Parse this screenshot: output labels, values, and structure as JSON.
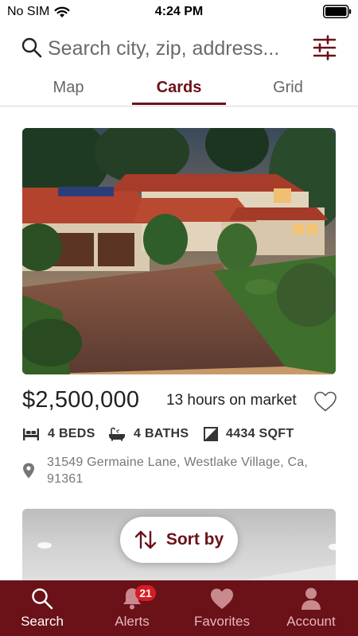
{
  "status_bar": {
    "carrier": "No SIM",
    "time": "4:24 PM"
  },
  "search": {
    "placeholder": "Search city, zip, address..."
  },
  "tabs": [
    {
      "label": "Map"
    },
    {
      "label": "Cards",
      "active": true
    },
    {
      "label": "Grid"
    }
  ],
  "listing": {
    "price": "$2,500,000",
    "time_on_market": "13 hours on market",
    "beds": "4 BEDS",
    "baths": "4 BATHS",
    "sqft": "4434 SQFT",
    "address": "31549 Germaine Lane, Westlake Village, Ca, 91361"
  },
  "sort": {
    "label": "Sort by"
  },
  "bottom_nav": {
    "items": [
      {
        "label": "Search",
        "icon": "search-icon",
        "active": true
      },
      {
        "label": "Alerts",
        "icon": "bell-icon",
        "badge": "21"
      },
      {
        "label": "Favorites",
        "icon": "heart-icon"
      },
      {
        "label": "Account",
        "icon": "person-icon"
      }
    ]
  },
  "colors": {
    "brand": "#6b1118",
    "badge": "#d81b23",
    "muted_text": "#777777"
  }
}
